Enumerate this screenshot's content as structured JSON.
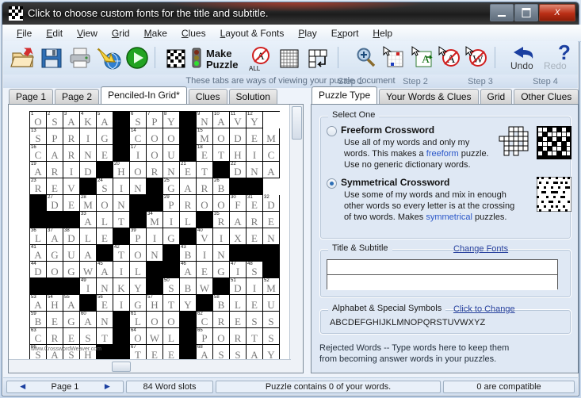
{
  "window": {
    "title": "Click to choose custom fonts for the title and subtitle.",
    "icon": "crossword-grid-icon",
    "minimize": "minimize-icon",
    "maximize": "maximize-icon",
    "close": "X"
  },
  "menu": [
    "File",
    "Edit",
    "View",
    "Grid",
    "Make",
    "Clues",
    "Layout & Fonts",
    "Play",
    "Export",
    "Help"
  ],
  "toolbar": {
    "items": [
      {
        "name": "open-folder-icon",
        "label": ""
      },
      {
        "name": "save-disk-icon",
        "label": ""
      },
      {
        "name": "print-icon",
        "label": ""
      },
      {
        "name": "export-web-icon",
        "label": ""
      },
      {
        "name": "play-icon",
        "label": ""
      },
      {
        "name": "puzzle-grid-icon",
        "label": ""
      },
      {
        "name": "traffic-light-icon",
        "label": ""
      },
      {
        "name": "make-puzzle-button",
        "label": "Make\nPuzzle"
      },
      {
        "name": "no-all-letters-icon",
        "label": "ALL"
      },
      {
        "name": "blank-grid-icon",
        "label": ""
      },
      {
        "name": "grid-shape-icon",
        "label": ""
      },
      {
        "name": "zoom-icon",
        "label": ""
      },
      {
        "name": "select-region-icon",
        "label": ""
      },
      {
        "name": "insert-letter-icon",
        "label": ""
      },
      {
        "name": "remove-letter-icon",
        "label": ""
      },
      {
        "name": "remove-word-icon",
        "label": ""
      },
      {
        "name": "undo-button",
        "label": "Undo"
      },
      {
        "name": "redo-button",
        "label": "Redo"
      },
      {
        "name": "help-question-icon",
        "label": "?"
      }
    ],
    "make_puzzle_line1": "Make",
    "make_puzzle_line2": "Puzzle",
    "all_label": "ALL",
    "undo_label": "Undo",
    "redo_label": "Redo",
    "help_label": "?"
  },
  "hint": "These tabs are ways of viewing your puzzle document",
  "steps": [
    "Step 1",
    "Step 2",
    "Step 3",
    "Step 4"
  ],
  "left_tabs": [
    {
      "label": "Page 1",
      "active": false
    },
    {
      "label": "Page 2",
      "active": false
    },
    {
      "label": "Penciled-In Grid*",
      "active": true
    },
    {
      "label": "Clues",
      "active": false
    },
    {
      "label": "Solution",
      "active": false
    }
  ],
  "right_tabs": [
    {
      "label": "Puzzle Type",
      "active": true
    },
    {
      "label": "Your Words & Clues",
      "active": false
    },
    {
      "label": "Grid",
      "active": false
    },
    {
      "label": "Other Clues",
      "active": false
    }
  ],
  "puzzle_type": {
    "group_title": "Select One",
    "options": [
      {
        "title": "Freeform Crossword",
        "selected": false,
        "lines": [
          "Use all of my words and only my",
          "words. This makes a freeform puzzle.",
          "Use no generic dictionary words."
        ],
        "link_word": "freeform"
      },
      {
        "title": "Symmetrical Crossword",
        "selected": true,
        "lines": [
          "Use some of my words and mix in enough",
          "other words so every letter is at the crossing",
          "of two words. Makes symmetrical puzzles."
        ],
        "link_word": "symmetrical"
      }
    ]
  },
  "title_subtitle": {
    "group_title": "Title & Subtitle",
    "change_fonts_link": "Change Fonts",
    "title_value": "",
    "subtitle_value": "",
    "title_placeholder": "",
    "subtitle_placeholder": ""
  },
  "alphabet": {
    "group_title": "Alphabet & Special Symbols",
    "change_link": "Click to Change",
    "value": "ABCDEFGHIJKLMNOPQRSTUVWXYZ"
  },
  "rejected_words": {
    "line1": "Rejected Words -- Type words here to keep them",
    "line2": "from becoming answer words in your puzzles."
  },
  "statusbar": {
    "prev_arrow": "◀",
    "page_label": "Page 1",
    "next_arrow": "▶",
    "word_slots": "84 Word slots",
    "contains": "Puzzle contains 0 of your words.",
    "compatible": "0 are compatible"
  },
  "watermark": "www.CrosswordWeaver.com",
  "colors": {
    "accent_link": "#27419e",
    "inline_link": "#2b57c8",
    "panel_bg": "#dfe8f4",
    "titlebar": "#262626",
    "close_red": "#bb2f16"
  },
  "crossword": {
    "cols": 14,
    "rows": 14,
    "grid": [
      [
        {
          "l": "O",
          "n": "1"
        },
        {
          "l": "S",
          "n": "2"
        },
        {
          "l": "A",
          "n": "3"
        },
        {
          "l": "K",
          "n": "4"
        },
        {
          "l": "A",
          "n": "5"
        },
        {
          "b": true
        },
        {
          "l": "S",
          "n": "6"
        },
        {
          "l": "P",
          "n": "7"
        },
        {
          "l": "Y",
          "n": "8"
        },
        {
          "b": true
        },
        {
          "l": "N",
          "n": "9"
        },
        {
          "l": "A",
          "n": "10"
        },
        {
          "l": "V",
          "n": "11"
        },
        {
          "l": "Y",
          "n": "12"
        }
      ],
      [
        {
          "l": "S",
          "n": "13"
        },
        {
          "l": "P"
        },
        {
          "l": "R"
        },
        {
          "l": "I"
        },
        {
          "l": "G"
        },
        {
          "b": true
        },
        {
          "l": "C",
          "n": "14"
        },
        {
          "l": "O"
        },
        {
          "l": "O"
        },
        {
          "b": true
        },
        {
          "l": "M",
          "n": "15"
        },
        {
          "l": "O"
        },
        {
          "l": "D"
        },
        {
          "l": "E"
        },
        {
          "l": "M"
        }
      ],
      [
        {
          "l": "C",
          "n": "16"
        },
        {
          "l": "A"
        },
        {
          "l": "R"
        },
        {
          "l": "N"
        },
        {
          "l": "E"
        },
        {
          "b": true
        },
        {
          "l": "I",
          "n": "17"
        },
        {
          "l": "O"
        },
        {
          "l": "U"
        },
        {
          "b": true
        },
        {
          "l": "E",
          "n": "18"
        },
        {
          "l": "T"
        },
        {
          "l": "H"
        },
        {
          "l": "I"
        },
        {
          "l": "C"
        }
      ],
      [
        {
          "l": "A",
          "n": "19"
        },
        {
          "l": "R"
        },
        {
          "l": "I"
        },
        {
          "l": "D"
        },
        {
          "b": true
        },
        {
          "l": "H",
          "n": "20"
        },
        {
          "l": "O"
        },
        {
          "l": "R"
        },
        {
          "l": "N"
        },
        {
          "l": "E",
          "n": "21"
        },
        {
          "l": "T"
        },
        {
          "b": true
        },
        {
          "l": "D",
          "n": "22"
        },
        {
          "l": "N"
        },
        {
          "l": "A"
        }
      ],
      [
        {
          "l": "R",
          "n": "23"
        },
        {
          "l": "E"
        },
        {
          "l": "V"
        },
        {
          "b": true
        },
        {
          "l": "S",
          "n": "24"
        },
        {
          "l": "I"
        },
        {
          "l": "N"
        },
        {
          "b": true
        },
        {
          "l": "G",
          "n": "25"
        },
        {
          "l": "A"
        },
        {
          "l": "R"
        },
        {
          "l": "B",
          "n": "26"
        },
        {
          "b": true
        },
        {
          "b": true
        }
      ],
      [
        {
          "b": true
        },
        {
          "l": "D",
          "n": "27"
        },
        {
          "l": "E"
        },
        {
          "l": "M",
          "n": "28"
        },
        {
          "l": "O"
        },
        {
          "l": "N"
        },
        {
          "b": true
        },
        {
          "b": true
        },
        {
          "l": "P",
          "n": "29"
        },
        {
          "l": "R"
        },
        {
          "l": "O"
        },
        {
          "l": "O"
        },
        {
          "l": "F",
          "n": "30"
        },
        {
          "l": "E",
          "n": "31"
        },
        {
          "l": "D",
          "n": "32"
        }
      ],
      [
        {
          "b": true
        },
        {
          "b": true
        },
        {
          "b": true
        },
        {
          "l": "A",
          "n": "33"
        },
        {
          "l": "L"
        },
        {
          "l": "T"
        },
        {
          "b": true
        },
        {
          "l": "M",
          "n": "34"
        },
        {
          "l": "I"
        },
        {
          "l": "L"
        },
        {
          "b": true
        },
        {
          "l": "R",
          "n": "35"
        },
        {
          "l": "A"
        },
        {
          "l": "R"
        },
        {
          "l": "E"
        }
      ],
      [
        {
          "l": "L",
          "n": "36"
        },
        {
          "l": "A",
          "n": "37"
        },
        {
          "l": "D",
          "n": "38"
        },
        {
          "l": "L"
        },
        {
          "l": "E"
        },
        {
          "b": true
        },
        {
          "l": "P",
          "n": "39"
        },
        {
          "l": "I"
        },
        {
          "l": "G"
        },
        {
          "b": true
        },
        {
          "l": "V",
          "n": "40"
        },
        {
          "l": "I"
        },
        {
          "l": "X"
        },
        {
          "l": "E"
        },
        {
          "l": "N"
        }
      ],
      [
        {
          "l": "A",
          "n": "41"
        },
        {
          "l": "G"
        },
        {
          "l": "U"
        },
        {
          "l": "A"
        },
        {
          "b": true
        },
        {
          "l": "T",
          "n": "42"
        },
        {
          "l": "O"
        },
        {
          "l": "N"
        },
        {
          "b": true
        },
        {
          "l": "B",
          "n": "43"
        },
        {
          "l": "I"
        },
        {
          "l": "N"
        },
        {
          "b": true
        },
        {
          "b": true
        },
        {
          "b": true
        }
      ],
      [
        {
          "l": "D",
          "n": "44"
        },
        {
          "l": "O"
        },
        {
          "l": "G"
        },
        {
          "l": "W"
        },
        {
          "l": "A",
          "n": "45"
        },
        {
          "l": "I"
        },
        {
          "l": "L"
        },
        {
          "b": true
        },
        {
          "b": true
        },
        {
          "l": "A",
          "n": "46"
        },
        {
          "l": "E"
        },
        {
          "l": "G"
        },
        {
          "l": "I",
          "n": "47"
        },
        {
          "l": "S",
          "n": "48"
        },
        {
          "b": true
        }
      ],
      [
        {
          "b": true
        },
        {
          "b": true
        },
        {
          "b": true
        },
        {
          "l": "I",
          "n": "49"
        },
        {
          "l": "N"
        },
        {
          "l": "K"
        },
        {
          "l": "Y"
        },
        {
          "b": true
        },
        {
          "l": "S",
          "n": "50"
        },
        {
          "l": "B"
        },
        {
          "l": "W"
        },
        {
          "b": true
        },
        {
          "l": "D",
          "n": "51"
        },
        {
          "l": "I"
        },
        {
          "l": "M",
          "n": "52"
        }
      ],
      [
        {
          "l": "A",
          "n": "53"
        },
        {
          "l": "H",
          "n": "54"
        },
        {
          "l": "A",
          "n": "55"
        },
        {
          "b": true
        },
        {
          "l": "E",
          "n": "56"
        },
        {
          "l": "I"
        },
        {
          "l": "G"
        },
        {
          "l": "H",
          "n": "57"
        },
        {
          "l": "T"
        },
        {
          "l": "Y"
        },
        {
          "b": true
        },
        {
          "l": "B",
          "n": "58"
        },
        {
          "l": "L"
        },
        {
          "l": "E"
        },
        {
          "l": "U"
        }
      ],
      [
        {
          "l": "B",
          "n": "59"
        },
        {
          "l": "E"
        },
        {
          "l": "G"
        },
        {
          "l": "A",
          "n": "60"
        },
        {
          "l": "N"
        },
        {
          "b": true
        },
        {
          "l": "L",
          "n": "61"
        },
        {
          "l": "O"
        },
        {
          "l": "O"
        },
        {
          "b": true
        },
        {
          "l": "C",
          "n": "62"
        },
        {
          "l": "R"
        },
        {
          "l": "E"
        },
        {
          "l": "S"
        },
        {
          "l": "S"
        }
      ],
      [
        {
          "l": "C",
          "n": "63"
        },
        {
          "l": "R"
        },
        {
          "l": "E"
        },
        {
          "l": "S"
        },
        {
          "l": "T"
        },
        {
          "b": true
        },
        {
          "l": "O",
          "n": "64"
        },
        {
          "l": "W"
        },
        {
          "l": "L"
        },
        {
          "b": true
        },
        {
          "l": "P",
          "n": "65"
        },
        {
          "l": "O"
        },
        {
          "l": "R"
        },
        {
          "l": "T"
        },
        {
          "l": "S"
        }
      ],
      [
        {
          "l": "S",
          "n": "66"
        },
        {
          "l": "A"
        },
        {
          "l": "S"
        },
        {
          "l": "H"
        },
        {
          "b": true
        },
        {
          "b": true
        },
        {
          "l": "T",
          "n": "67"
        },
        {
          "l": "E"
        },
        {
          "l": "E"
        },
        {
          "b": true
        },
        {
          "l": "A",
          "n": "68"
        },
        {
          "l": "S"
        },
        {
          "l": "S"
        },
        {
          "l": "A"
        },
        {
          "l": "Y"
        }
      ]
    ]
  }
}
